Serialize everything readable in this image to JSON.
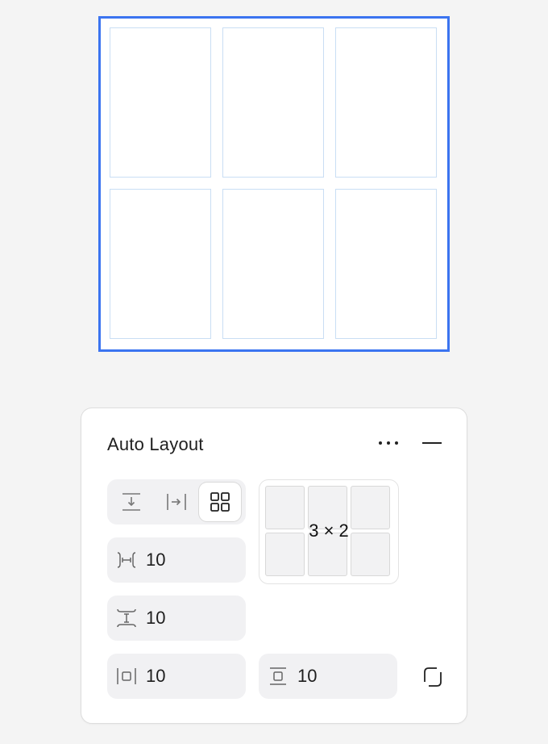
{
  "panel": {
    "title": "Auto Layout",
    "more_icon": "more-horizontal-icon",
    "collapse_icon": "minus-icon"
  },
  "direction": {
    "options": [
      {
        "id": "vertical",
        "icon": "arrow-down-icon"
      },
      {
        "id": "horizontal",
        "icon": "arrow-right-icon"
      },
      {
        "id": "grid",
        "icon": "grid-icon"
      }
    ],
    "selected": "grid"
  },
  "grid": {
    "label": "3 × 2",
    "columns": 3,
    "rows": 2
  },
  "fields": {
    "horizontal_gap": "10",
    "vertical_gap": "10",
    "horizontal_padding": "10",
    "vertical_padding": "10"
  },
  "colors": {
    "selection": "#3b74f0",
    "cell_outline": "#c9def4",
    "panel_bg": "#ffffff",
    "page_bg": "#f4f4f4"
  }
}
